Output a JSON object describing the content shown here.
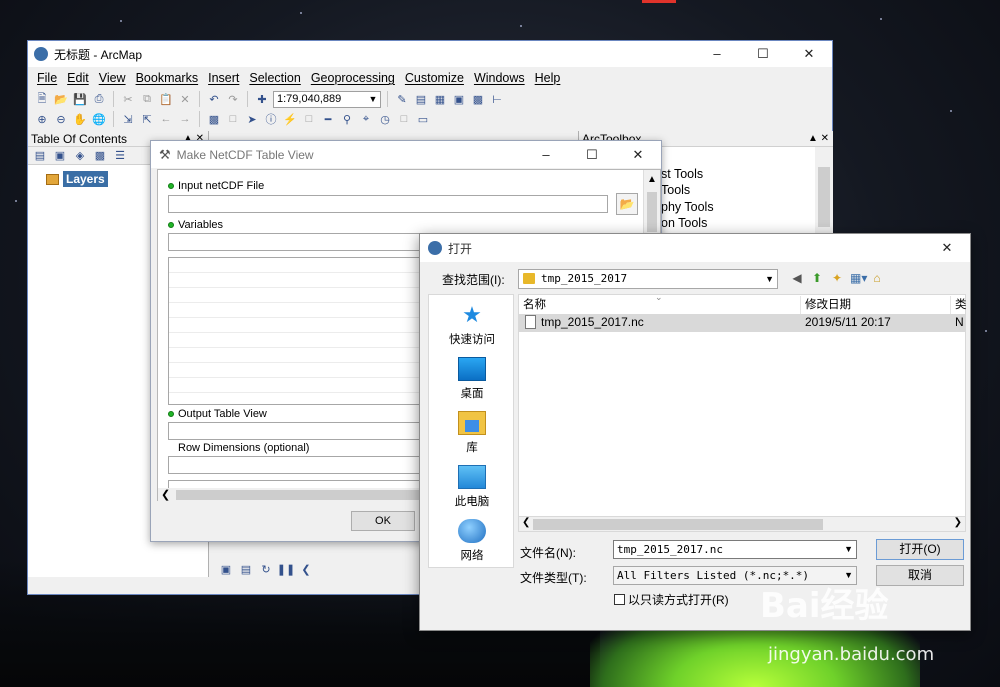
{
  "arcmap": {
    "title": "无标题 - ArcMap",
    "menu": [
      "File",
      "Edit",
      "View",
      "Bookmarks",
      "Insert",
      "Selection",
      "Geoprocessing",
      "Customize",
      "Windows",
      "Help"
    ],
    "scale": "1:79,040,889",
    "toc_title": "Table Of Contents",
    "layers_label": "Layers",
    "arctoolbox_title": "ArcToolbox",
    "arctoolbox_items": [
      "st Tools",
      "Tools",
      "phy Tools",
      "on Tools"
    ]
  },
  "netcdf_dialog": {
    "title": "Make NetCDF Table View",
    "input_label": "Input netCDF File",
    "variables_label": "Variables",
    "output_label": "Output Table View",
    "row_dims_label": "Row Dimensions (optional)",
    "ok_label": "OK"
  },
  "open_dialog": {
    "title": "打开",
    "look_in_label": "查找范围(I):",
    "look_in_value": "tmp_2015_2017",
    "places": [
      {
        "label": "快速访问",
        "icon": "quick-access-icon"
      },
      {
        "label": "桌面",
        "icon": "desktop-icon"
      },
      {
        "label": "库",
        "icon": "library-icon"
      },
      {
        "label": "此电脑",
        "icon": "this-pc-icon"
      },
      {
        "label": "网络",
        "icon": "network-icon"
      }
    ],
    "columns": [
      "名称",
      "修改日期",
      "类"
    ],
    "files": [
      {
        "name": "tmp_2015_2017.nc",
        "modified": "2019/5/11 20:17",
        "type": "N"
      }
    ],
    "filename_label": "文件名(N):",
    "filename_value": "tmp_2015_2017.nc",
    "filetype_label": "文件类型(T):",
    "filetype_value": "All Filters Listed (*.nc;*.*)",
    "readonly_label": "以只读方式打开(R)",
    "open_button": "打开(O)",
    "cancel_button": "取消"
  },
  "watermark": {
    "brand": "Bai经验",
    "url": "jingyan.baidu.com"
  },
  "colors": {
    "selection": "#3a6ea5",
    "required_dot": "#21b528"
  }
}
